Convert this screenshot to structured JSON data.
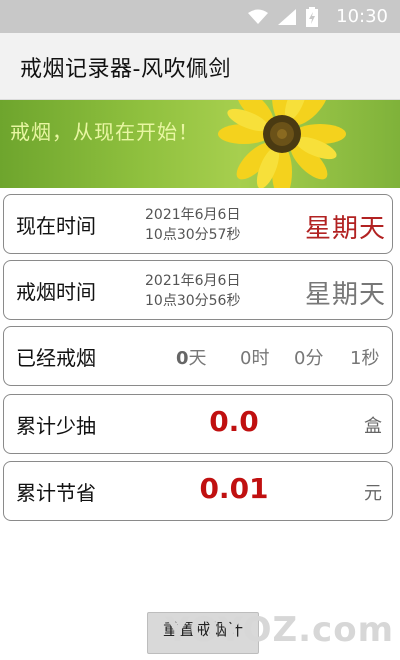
{
  "status_bar": {
    "time": "10:30"
  },
  "app": {
    "title": "戒烟记录器-风吹佩剑"
  },
  "banner": {
    "slogan": "戒烟，从现在开始！"
  },
  "rows": {
    "now": {
      "label": "现在时间",
      "date": "2021年6月6日",
      "time": "10点30分57秒",
      "weekday": "星期天"
    },
    "quit": {
      "label": "戒烟时间",
      "date": "2021年6月6日",
      "time": "10点30分56秒",
      "weekday": "星期天"
    },
    "elapsed": {
      "label": "已经戒烟",
      "days": "0",
      "days_unit": "天",
      "hours": "0",
      "hours_unit": "时",
      "minutes": "0",
      "minutes_unit": "分",
      "seconds": "1",
      "seconds_unit": "秒"
    },
    "less_smoked": {
      "label": "累计少抽",
      "value": "0.0",
      "unit": "盒"
    },
    "saved": {
      "label": "累计节省",
      "value": "0.01",
      "unit": "元"
    }
  },
  "reset_button": {
    "label": "重置戒烟计"
  },
  "watermark": {
    "text": "YOYOZ.com"
  }
}
